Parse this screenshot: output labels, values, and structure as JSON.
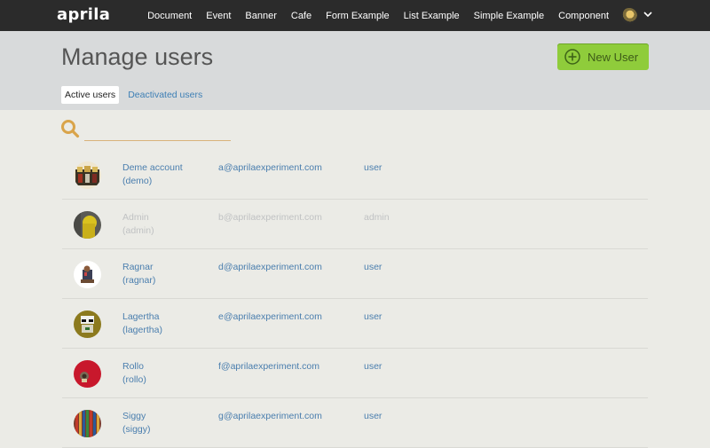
{
  "navbar": {
    "brand": "aprila",
    "links": [
      "Document",
      "Event",
      "Banner",
      "Cafe",
      "Form Example",
      "List Example",
      "Simple Example",
      "Component"
    ],
    "avatar_icon": "user-avatar",
    "chevron_icon": "chevron-down-icon"
  },
  "header": {
    "title": "Manage users",
    "new_user_label": "New User",
    "tabs": [
      {
        "label": "Active users",
        "active": true
      },
      {
        "label": "Deactivated users",
        "active": false
      }
    ]
  },
  "search": {
    "value": "",
    "placeholder": ""
  },
  "users": [
    {
      "name": "Deme account",
      "username": "(demo)",
      "email": "a@aprilaexperiment.com",
      "role": "user",
      "disabled": false
    },
    {
      "name": "Admin",
      "username": "(admin)",
      "email": "b@aprilaexperiment.com",
      "role": "admin",
      "disabled": true
    },
    {
      "name": "Ragnar",
      "username": "(ragnar)",
      "email": "d@aprilaexperiment.com",
      "role": "user",
      "disabled": false
    },
    {
      "name": "Lagertha",
      "username": "(lagertha)",
      "email": "e@aprilaexperiment.com",
      "role": "user",
      "disabled": false
    },
    {
      "name": "Rollo",
      "username": "(rollo)",
      "email": "f@aprilaexperiment.com",
      "role": "user",
      "disabled": false
    },
    {
      "name": "Siggy",
      "username": "(siggy)",
      "email": "g@aprilaexperiment.com",
      "role": "user",
      "disabled": false
    }
  ],
  "colors": {
    "navbar": "#2b2b2b",
    "header": "#d8dadb",
    "background": "#ebebe6",
    "accent_button": "#8fcc3b",
    "link": "#4a7eae",
    "search_underline": "#d9b27a"
  }
}
